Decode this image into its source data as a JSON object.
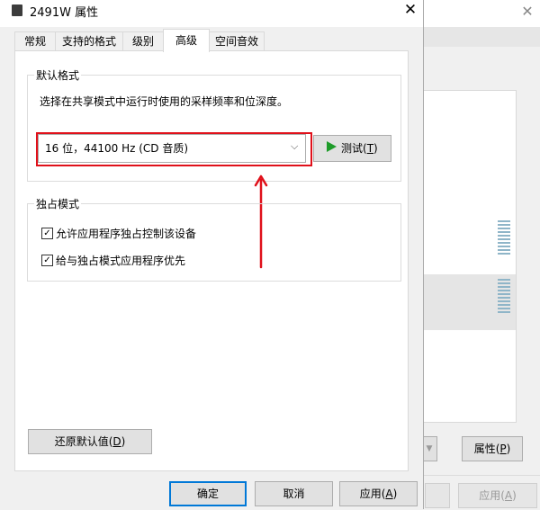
{
  "dialog": {
    "title": "2491W 属性",
    "close_glyph": "✕"
  },
  "tabs": [
    {
      "label": "常规",
      "active": false
    },
    {
      "label": "支持的格式",
      "active": false
    },
    {
      "label": "级别",
      "active": false
    },
    {
      "label": "高级",
      "active": true
    },
    {
      "label": "空间音效",
      "active": false
    }
  ],
  "default_format": {
    "legend": "默认格式",
    "description": "选择在共享模式中运行时使用的采样频率和位深度。",
    "selected": "16 位，44100 Hz (CD 音质)",
    "test_label_pre": "测试(",
    "test_label_key": "T",
    "test_label_post": ")"
  },
  "exclusive_mode": {
    "legend": "独占模式",
    "options": [
      {
        "label": "允许应用程序独占控制该设备",
        "checked": true
      },
      {
        "label": "给与独占模式应用程序优先",
        "checked": true
      }
    ]
  },
  "restore": {
    "pre": "还原默认值(",
    "key": "D",
    "post": ")"
  },
  "footer": {
    "ok": "确定",
    "cancel": "取消",
    "apply_pre": "应用(",
    "apply_key": "A",
    "apply_post": ")"
  },
  "background_window": {
    "close_glyph": "✕",
    "properties_pre": "属性(",
    "properties_key": "P",
    "properties_post": ")",
    "apply_pre": "应用(",
    "apply_key": "A",
    "apply_post": ")"
  },
  "colors": {
    "highlight": "#e0101a",
    "play": "#1e9c2a",
    "focus": "#0078d7"
  }
}
